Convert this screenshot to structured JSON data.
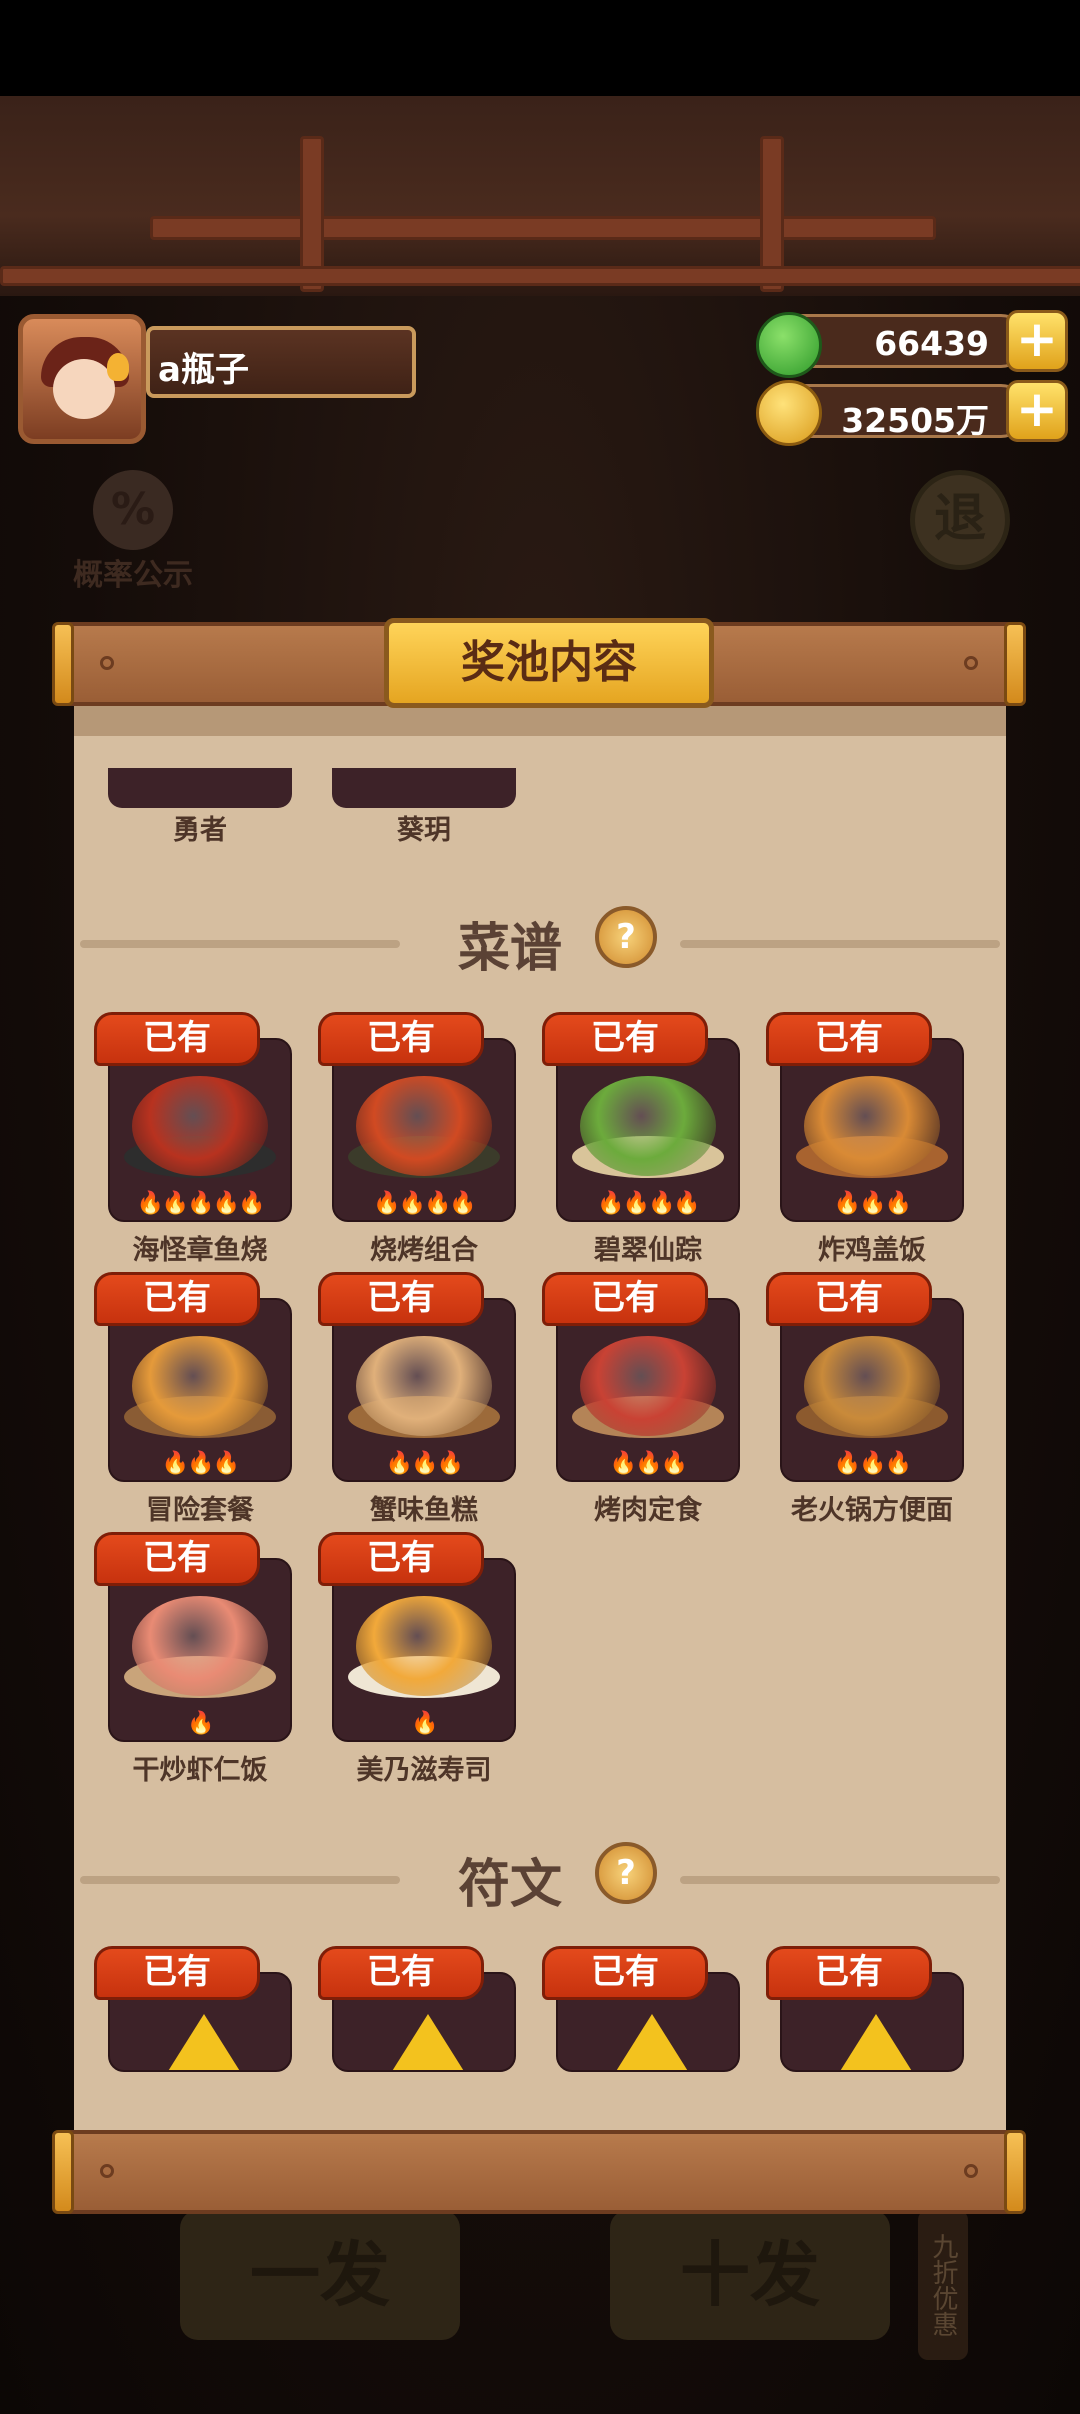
{
  "player": {
    "name": "a瓶子"
  },
  "currency": {
    "gems": "66439",
    "coins": "32505万",
    "plus": "+"
  },
  "background": {
    "probability_label": "概率公示",
    "probability_icon": "%",
    "exit_label": "退",
    "draw_one": "一发",
    "draw_ten": "十发",
    "discount": "九折优惠"
  },
  "panel": {
    "title": "奖池内容",
    "characters": [
      {
        "name": "勇者"
      },
      {
        "name": "葵玥"
      }
    ],
    "recipe_section": {
      "title": "菜谱",
      "help": "?"
    },
    "recipes": [
      {
        "name": "海怪章鱼烧",
        "status": "已有",
        "stars": 5,
        "color": "#b8321f",
        "plate": "#2d2d2d"
      },
      {
        "name": "烧烤组合",
        "status": "已有",
        "stars": 4,
        "color": "#d14a22",
        "plate": "#3b3b2a"
      },
      {
        "name": "碧翠仙踪",
        "status": "已有",
        "stars": 4,
        "color": "#6cab3c",
        "plate": "#d9c49a"
      },
      {
        "name": "炸鸡盖饭",
        "status": "已有",
        "stars": 3,
        "color": "#d98a35",
        "plate": "#a8632f"
      },
      {
        "name": "冒险套餐",
        "status": "已有",
        "stars": 3,
        "color": "#e59a3a",
        "plate": "#8a5c34"
      },
      {
        "name": "蟹味鱼糕",
        "status": "已有",
        "stars": 3,
        "color": "#e0b07a",
        "plate": "#9c6a3a"
      },
      {
        "name": "烤肉定食",
        "status": "已有",
        "stars": 3,
        "color": "#c94234",
        "plate": "#b48457"
      },
      {
        "name": "老火锅方便面",
        "status": "已有",
        "stars": 3,
        "color": "#c98a3a",
        "plate": "#8c5a2e"
      },
      {
        "name": "干炒虾仁饭",
        "status": "已有",
        "stars": 1,
        "color": "#e98b74",
        "plate": "#c9a47a"
      },
      {
        "name": "美乃滋寿司",
        "status": "已有",
        "stars": 1,
        "color": "#f2a93a",
        "plate": "#efe6d4"
      }
    ],
    "rune_section": {
      "title": "符文",
      "help": "?"
    },
    "runes": [
      {
        "status": "已有"
      },
      {
        "status": "已有"
      },
      {
        "status": "已有"
      },
      {
        "status": "已有"
      }
    ]
  },
  "colors": {
    "owned_tag": "#d93a14",
    "card_bg": "#3d2228",
    "panel_bg": "#d6bea0",
    "gold": "#f3c21e"
  }
}
